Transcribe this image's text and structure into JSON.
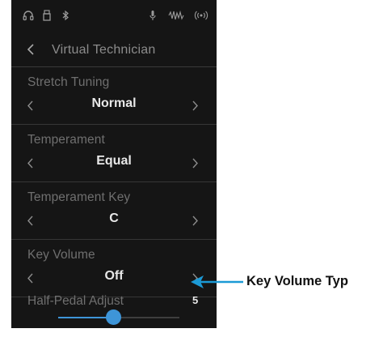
{
  "screen": {
    "title": "Virtual Technician",
    "settings": [
      {
        "label": "Stretch Tuning",
        "value": "Normal"
      },
      {
        "label": "Temperament",
        "value": "Equal"
      },
      {
        "label": "Temperament Key",
        "value": "C"
      },
      {
        "label": "Key Volume",
        "value": "Off"
      }
    ],
    "half_pedal": {
      "label": "Half-Pedal Adjust",
      "value": "5",
      "level": 0.45
    }
  },
  "status_icons": [
    "headphones-icon",
    "usb-icon",
    "bluetooth-icon",
    "mic-icon",
    "waveform-icon",
    "wireless-icon"
  ],
  "annotation": {
    "label": "Key Volume Typ"
  },
  "colors": {
    "background": "#151515",
    "accent": "#3e95d8",
    "value_text": "#e8e8e8",
    "label_text": "#6f6f6f"
  }
}
